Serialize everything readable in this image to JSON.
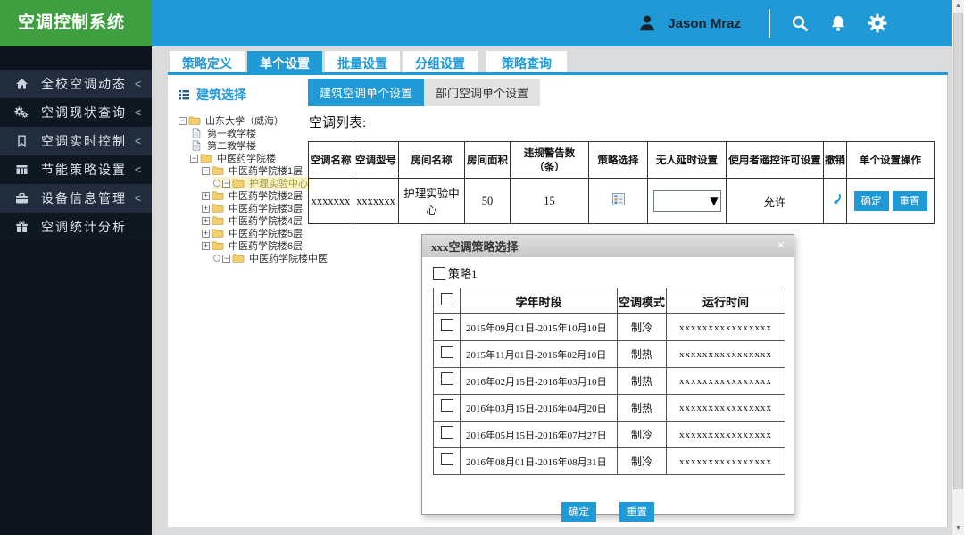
{
  "colors": {
    "accent": "#1f9ad6",
    "green": "#3f9f40",
    "sidebar_bg": "#0d141d",
    "sidebar_item_light": "#212d3d",
    "sidebar_item_dark": "#0f1721",
    "tree_selected_bg": "#f7f3c6"
  },
  "header": {
    "title": "空调控制系统",
    "user": "Jason Mraz"
  },
  "sidebar": {
    "items": [
      {
        "name": "campus-ac-status",
        "label": "全校空调动态",
        "icon": "home",
        "chevron": "<"
      },
      {
        "name": "ac-status-query",
        "label": "空调现状查询",
        "icon": "gears",
        "chevron": "<"
      },
      {
        "name": "ac-realtime-control",
        "label": "空调实时控制",
        "icon": "bookmark",
        "chevron": "<"
      },
      {
        "name": "energy-policy-setting",
        "label": "节能策略设置",
        "icon": "table",
        "chevron": "<"
      },
      {
        "name": "device-info-management",
        "label": "设备信息管理",
        "icon": "briefcase",
        "chevron": "<"
      },
      {
        "name": "ac-statistics",
        "label": "空调统计分析",
        "icon": "gift",
        "chevron": ""
      }
    ]
  },
  "tabs": [
    {
      "name": "policy-define",
      "label": "策略定义",
      "active": false
    },
    {
      "name": "single-setting",
      "label": "单个设置",
      "active": true
    },
    {
      "name": "batch-setting",
      "label": "批量设置",
      "active": false
    },
    {
      "name": "group-setting",
      "label": "分组设置",
      "active": false
    },
    {
      "name": "policy-query",
      "label": "策略查询",
      "active": false
    }
  ],
  "tree": {
    "header": "建筑选择",
    "nodes": [
      {
        "label": "山东大学（威海）",
        "level": 0,
        "icon": "folder",
        "exp": "-",
        "circle": false,
        "selected": false
      },
      {
        "label": "第一教学楼",
        "level": 1,
        "icon": "file",
        "exp": "",
        "circle": false,
        "selected": false
      },
      {
        "label": "第二教学楼",
        "level": 1,
        "icon": "file",
        "exp": "",
        "circle": false,
        "selected": false
      },
      {
        "label": "中医药学院楼",
        "level": 1,
        "icon": "folder",
        "exp": "-",
        "circle": false,
        "selected": false
      },
      {
        "label": "中医药学院楼1层",
        "level": 2,
        "icon": "folder",
        "exp": "-",
        "circle": false,
        "selected": false
      },
      {
        "label": "护理实验中心",
        "level": 3,
        "icon": "folder",
        "exp": "-",
        "circle": true,
        "selected": true
      },
      {
        "label": "中医药学院楼2层",
        "level": 2,
        "icon": "folder",
        "exp": "+",
        "circle": false,
        "selected": false
      },
      {
        "label": "中医药学院楼3层",
        "level": 2,
        "icon": "folder",
        "exp": "+",
        "circle": false,
        "selected": false
      },
      {
        "label": "中医药学院楼4层",
        "level": 2,
        "icon": "folder",
        "exp": "+",
        "circle": false,
        "selected": false
      },
      {
        "label": "中医药学院楼5层",
        "level": 2,
        "icon": "folder",
        "exp": "+",
        "circle": false,
        "selected": false
      },
      {
        "label": "中医药学院楼6层",
        "level": 2,
        "icon": "folder",
        "exp": "+",
        "circle": false,
        "selected": false
      },
      {
        "label": "中医药学院楼中医",
        "level": 3,
        "icon": "folder",
        "exp": "-",
        "circle": true,
        "selected": false
      }
    ]
  },
  "subtabs": [
    {
      "name": "building-ac-single",
      "label": "建筑空调单个设置",
      "active": true
    },
    {
      "name": "department-ac-single",
      "label": "部门空调单个设置",
      "active": false
    }
  ],
  "list_label": "空调列表:",
  "ac_table": {
    "headers": [
      "空调名称",
      "空调型号",
      "房间名称",
      "房间面积",
      "违规警告数（条）",
      "策略选择",
      "无人延时设置",
      "使用者遥控许可设置",
      "撤销",
      "单个设置操作"
    ],
    "row": {
      "name": "xxxxxxx",
      "model": "xxxxxxx",
      "room": "护理实验中心",
      "area": "50",
      "warnings": "15",
      "policy_icon": "policy-grid",
      "delay_value": "",
      "permission": "允许",
      "undo_icon": "undo",
      "actions": [
        "确定",
        "重置"
      ]
    }
  },
  "modal": {
    "title": "xxx空调策略选择",
    "close": "×",
    "policy_label": "策略1",
    "table": {
      "headers": [
        "学年时段",
        "空调模式",
        "运行时间"
      ],
      "rows": [
        {
          "period": "2015年09月01日-2015年10月10日",
          "mode": "制冷",
          "runtime": "xxxxxxxxxxxxxxxx"
        },
        {
          "period": "2015年11月01日-2016年02月10日",
          "mode": "制热",
          "runtime": "xxxxxxxxxxxxxxxx"
        },
        {
          "period": "2016年02月15日-2016年03月10日",
          "mode": "制热",
          "runtime": "xxxxxxxxxxxxxxxx"
        },
        {
          "period": "2016年03月15日-2016年04月20日",
          "mode": "制热",
          "runtime": "xxxxxxxxxxxxxxxx"
        },
        {
          "period": "2016年05月15日-2016年07月27日",
          "mode": "制冷",
          "runtime": "xxxxxxxxxxxxxxxx"
        },
        {
          "period": "2016年08月01日-2016年08月31日",
          "mode": "制冷",
          "runtime": "xxxxxxxxxxxxxxxx"
        }
      ]
    },
    "buttons": [
      "确定",
      "重置"
    ]
  }
}
